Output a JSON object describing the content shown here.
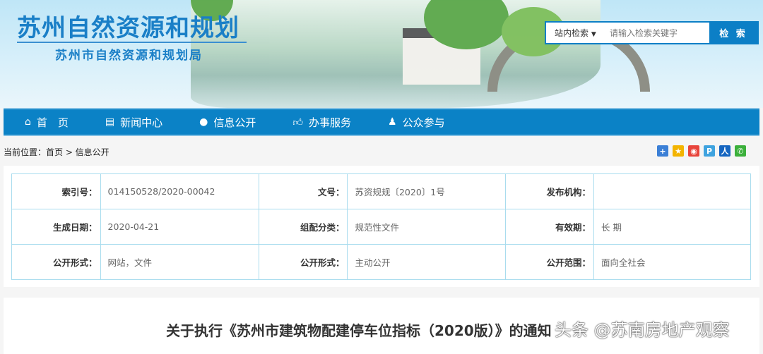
{
  "header": {
    "logo_title": "苏州自然资源和规划",
    "logo_subtitle": "苏州市自然资源和规划局"
  },
  "search": {
    "scope": "站内检索",
    "placeholder": "请输入检索关键字",
    "button": "检 索"
  },
  "nav": [
    {
      "icon": "home-icon",
      "label": "首　页"
    },
    {
      "icon": "newspaper-icon",
      "label": "新闻中心"
    },
    {
      "icon": "globe-icon",
      "label": "信息公开"
    },
    {
      "icon": "thumbs-up-icon",
      "label": "办事服务"
    },
    {
      "icon": "user-icon",
      "label": "公众参与"
    }
  ],
  "breadcrumb": "当前位置：首页 > 信息公开",
  "share": [
    {
      "icon": "plus-share-icon",
      "color": "#3b7fd6"
    },
    {
      "icon": "qzone-icon",
      "color": "#f3b400"
    },
    {
      "icon": "weibo-icon",
      "color": "#e8453c"
    },
    {
      "icon": "tencent-icon",
      "color": "#3fa3df"
    },
    {
      "icon": "renren-icon",
      "color": "#1565c0"
    },
    {
      "icon": "wechat-icon",
      "color": "#3bb03b"
    }
  ],
  "meta": [
    [
      {
        "k": "索引号：",
        "v": "014150528/2020-00042"
      },
      {
        "k": "文号：",
        "v": "苏资规规〔2020〕1号"
      },
      {
        "k": "发布机构：",
        "v": ""
      }
    ],
    [
      {
        "k": "生成日期：",
        "v": "2020-04-21"
      },
      {
        "k": "组配分类：",
        "v": "规范性文件"
      },
      {
        "k": "有效期：",
        "v": "长 期"
      }
    ],
    [
      {
        "k": "公开形式：",
        "v": "网站，文件"
      },
      {
        "k": "公开形式：",
        "v": "主动公开"
      },
      {
        "k": "公开范围：",
        "v": "面向全社会"
      }
    ]
  ],
  "article": {
    "title": "关于执行《苏州市建筑物配建停车位指标（2020版）》的通知",
    "watermark": "头条 @苏南房地产观察"
  }
}
